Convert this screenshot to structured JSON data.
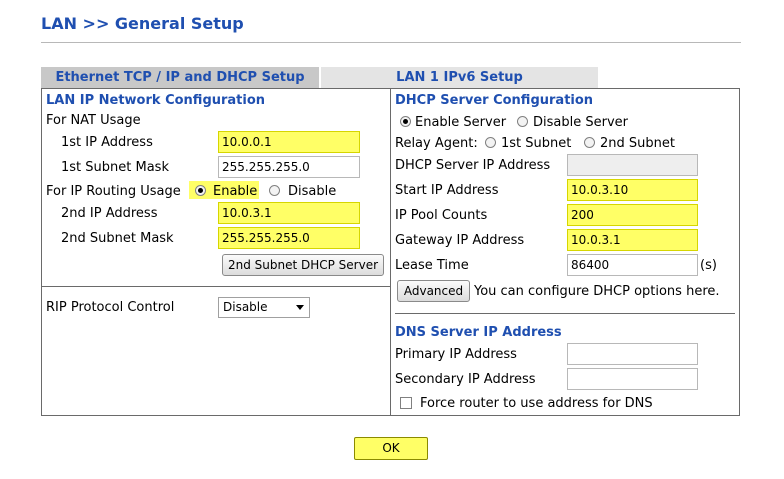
{
  "page_title": "LAN >> General Setup",
  "tabs": [
    {
      "label": "Ethernet TCP / IP and DHCP Setup"
    },
    {
      "label": "LAN 1 IPv6 Setup"
    }
  ],
  "lan_ip": {
    "heading": "LAN IP Network Configuration",
    "nat_usage": "For NAT Usage",
    "ip1_label": "1st IP Address",
    "ip1_value": "10.0.0.1",
    "mask1_label": "1st Subnet Mask",
    "mask1_value": "255.255.255.0",
    "routing_usage": "For IP Routing Usage",
    "enable_label": "Enable",
    "disable_label": "Disable",
    "ip2_label": "2nd IP Address",
    "ip2_value": "10.0.3.1",
    "mask2_label": "2nd Subnet Mask",
    "mask2_value": "255.255.255.0",
    "dhcp2_button": "2nd Subnet DHCP Server"
  },
  "rip": {
    "label": "RIP Protocol Control",
    "value": "Disable"
  },
  "dhcp": {
    "heading": "DHCP Server Configuration",
    "enable_server": "Enable Server",
    "disable_server": "Disable Server",
    "relay_agent": "Relay Agent:",
    "relay_1st": "1st Subnet",
    "relay_2nd": "2nd Subnet",
    "server_ip_label": "DHCP Server IP Address",
    "server_ip_value": "",
    "start_ip_label": "Start IP Address",
    "start_ip_value": "10.0.3.10",
    "pool_label": "IP Pool Counts",
    "pool_value": "200",
    "gateway_label": "Gateway IP Address",
    "gateway_value": "10.0.3.1",
    "lease_label": "Lease Time",
    "lease_value": "86400",
    "lease_unit": "(s)",
    "advanced_button": "Advanced",
    "advanced_hint": "You can configure DHCP options here."
  },
  "dns": {
    "heading": "DNS Server IP Address",
    "primary_label": "Primary IP Address",
    "primary_value": "",
    "secondary_label": "Secondary IP Address",
    "secondary_value": "",
    "force_label": "Force router to use address for DNS"
  },
  "ok_button": "OK"
}
